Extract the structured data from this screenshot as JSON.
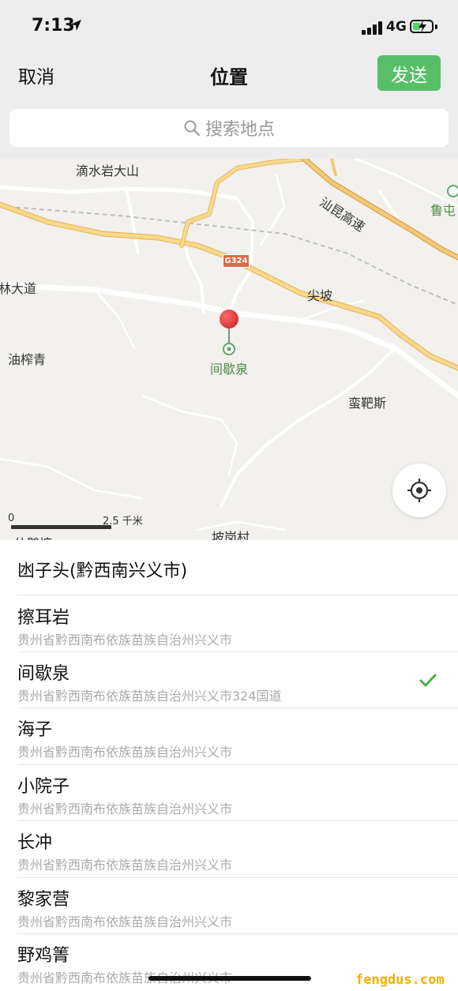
{
  "status_bar": {
    "time": "7:13",
    "network": "4G"
  },
  "nav": {
    "cancel_label": "取消",
    "title": "位置",
    "send_label": "发送"
  },
  "search": {
    "placeholder": "搜索地点"
  },
  "map": {
    "place_labels": {
      "dishuiyan": "滴水岩大山",
      "expressway": "汕昆高速",
      "luzhuang": "鲁屯",
      "lindadao": "林大道",
      "jianpo": "尖坡",
      "youzhaqing": "油榨青",
      "manbasi": "蛮靶斯",
      "pogangcun": "坡岗村",
      "bottom_left_partial": "仙鹅塘",
      "poi_jianxiequan": "间歇泉"
    },
    "road_shield": "G324",
    "scale": {
      "zero": "0",
      "distance": "2.5 千米"
    }
  },
  "results": [
    {
      "name": "凼子头(黔西南兴义市)",
      "address": "",
      "selected": false
    },
    {
      "name": "擦耳岩",
      "address": "贵州省黔西南布依族苗族自治州兴义市",
      "selected": false
    },
    {
      "name": "间歇泉",
      "address": "贵州省黔西南布依族苗族自治州兴义市324国道",
      "selected": true
    },
    {
      "name": "海子",
      "address": "贵州省黔西南布依族苗族自治州兴义市",
      "selected": false
    },
    {
      "name": "小院子",
      "address": "贵州省黔西南布依族苗族自治州兴义市",
      "selected": false
    },
    {
      "name": "长冲",
      "address": "贵州省黔西南布依族苗族自治州兴义市",
      "selected": false
    },
    {
      "name": "黎家营",
      "address": "贵州省黔西南布依族苗族自治州兴义市",
      "selected": false
    },
    {
      "name": "野鸡箐",
      "address": "贵州省黔西南布依族苗族自治州兴义市",
      "selected": false
    }
  ],
  "watermark": "fengdus.com",
  "colors": {
    "accent_green": "#58be6a",
    "check_green": "#4caf50",
    "pin_red": "#e53935",
    "highway_yellow": "#f5c97a"
  }
}
